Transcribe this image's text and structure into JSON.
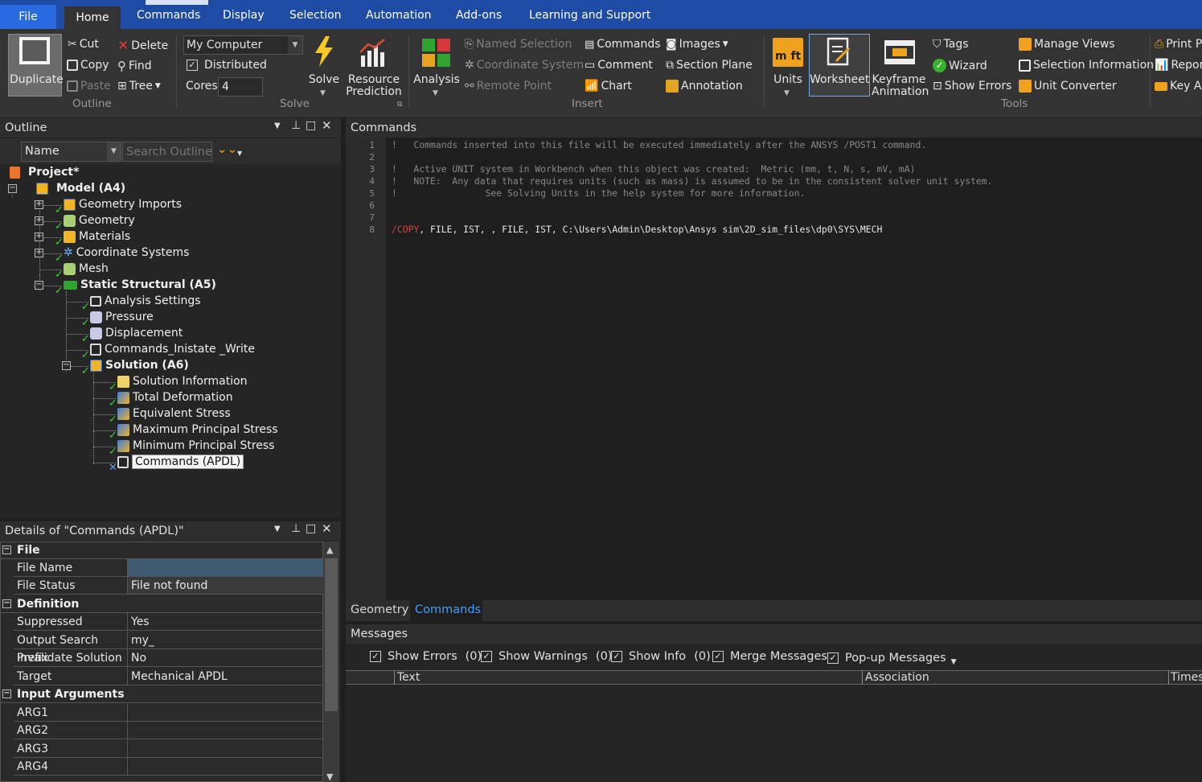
{
  "ribbon": {
    "tabs": {
      "file": "File",
      "home": "Home",
      "commands": "Commands",
      "display": "Display",
      "selection": "Selection",
      "automation": "Automation",
      "addons": "Add-ons",
      "learning": "Learning and Support"
    },
    "outline": {
      "duplicate": "Duplicate",
      "cut": "Cut",
      "copy": "Copy",
      "paste": "Paste",
      "delete": "Delete",
      "find": "Find",
      "tree": "Tree",
      "group": "Outline"
    },
    "solve": {
      "computer": "My Computer",
      "distributed": "Distributed",
      "cores_label": "Cores",
      "cores_value": "4",
      "solve": "Solve",
      "resource": "Resource",
      "prediction": "Prediction",
      "group": "Solve"
    },
    "insert": {
      "analysis": "Analysis",
      "named_selection": "Named Selection",
      "coordinate_system": "Coordinate System",
      "remote_point": "Remote Point",
      "commands": "Commands",
      "comment": "Comment",
      "chart": "Chart",
      "images": "Images",
      "section_plane": "Section Plane",
      "annotation": "Annotation",
      "group": "Insert"
    },
    "tools": {
      "units": "Units",
      "worksheet": "Worksheet",
      "keyframe": "Keyframe",
      "animation": "Animation",
      "tags": "Tags",
      "wizard": "Wizard",
      "show_errors": "Show Errors",
      "manage_views": "Manage Views",
      "selection_information": "Selection Information",
      "unit_converter": "Unit Converter",
      "print": "Print P",
      "report": "Repor",
      "key": "Key As",
      "group": "Tools"
    }
  },
  "outline_panel": {
    "title": "Outline",
    "name_label": "Name",
    "search_placeholder": "Search Outline",
    "tree": {
      "project": "Project*",
      "model": "Model (A4)",
      "geometry_imports": "Geometry Imports",
      "geometry": "Geometry",
      "materials": "Materials",
      "coordinate_systems": "Coordinate Systems",
      "mesh": "Mesh",
      "static": "Static Structural (A5)",
      "analysis_settings": "Analysis Settings",
      "pressure": "Pressure",
      "displacement": "Displacement",
      "commands_write": "Commands_Inistate _Write",
      "solution": "Solution (A6)",
      "solution_info": "Solution Information",
      "total_def": "Total Deformation",
      "eq_stress": "Equivalent Stress",
      "max_stress": "Maximum Principal Stress",
      "min_stress": "Minimum Principal Stress",
      "commands_apdl": "Commands (APDL)"
    }
  },
  "details_panel": {
    "title": "Details of \"Commands (APDL)\"",
    "sections": {
      "file": "File",
      "definition": "Definition",
      "input": "Input Arguments"
    },
    "rows": {
      "file_name": {
        "k": "File Name",
        "v": ""
      },
      "file_status": {
        "k": "File Status",
        "v": "File not found"
      },
      "suppressed": {
        "k": "Suppressed",
        "v": "Yes"
      },
      "prefix": {
        "k": "Output Search Prefix",
        "v": "my_"
      },
      "invalidate": {
        "k": "Invalidate Solution",
        "v": "No"
      },
      "target": {
        "k": "Target",
        "v": "Mechanical APDL"
      },
      "arg1": {
        "k": "ARG1",
        "v": ""
      },
      "arg2": {
        "k": "ARG2",
        "v": ""
      },
      "arg3": {
        "k": "ARG3",
        "v": ""
      },
      "arg4": {
        "k": "ARG4",
        "v": ""
      }
    }
  },
  "editor": {
    "title": "Commands",
    "lines": {
      "l1": "!   Commands inserted into this file will be executed immediately after the ANSYS /POST1 command.",
      "l2": "",
      "l3": "!   Active UNIT system in Workbench when this object was created:  Metric (mm, t, N, s, mV, mA)",
      "l4": "!   NOTE:  Any data that requires units (such as mass) is assumed to be in the consistent solver unit system.",
      "l5": "!                See Solving Units in the help system for more information.",
      "l8_cmd": "/COPY",
      "l8_rest": ", FILE, IST, , FILE, IST, C:\\Users\\Admin\\Desktop\\Ansys sim\\2D_sim_files\\dp0\\SYS\\MECH"
    },
    "line_numbers": [
      "1",
      "2",
      "3",
      "4",
      "5",
      "6",
      "7",
      "8"
    ],
    "tabs": {
      "geometry": "Geometry",
      "commands": "Commands"
    }
  },
  "messages": {
    "title": "Messages",
    "show_errors": "Show Errors",
    "errors_count": "(0)",
    "show_warnings": "Show Warnings",
    "warnings_count": "(0)",
    "show_info": "Show Info",
    "info_count": "(0)",
    "merge": "Merge Messages",
    "popup": "Pop-up Messages",
    "cols": {
      "text": "Text",
      "association": "Association",
      "time": "Times"
    }
  },
  "colors": {
    "accent": "#1e4ba3",
    "file_tab": "#2a6ae0",
    "comment": "#888888",
    "copy_cmd": "#e04040",
    "check": "#39d12e"
  }
}
